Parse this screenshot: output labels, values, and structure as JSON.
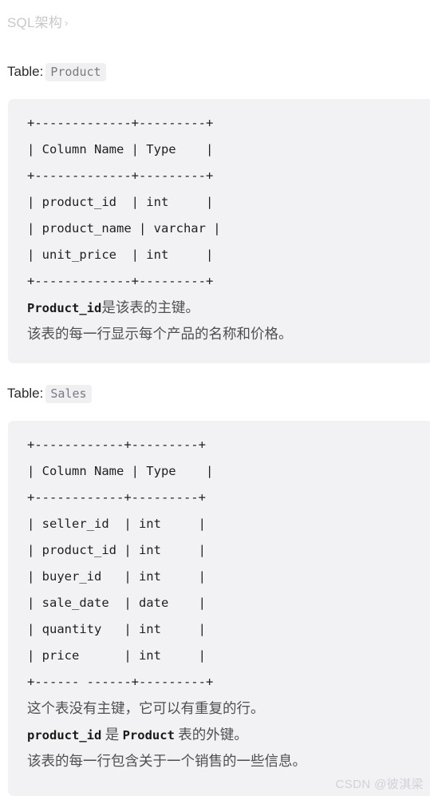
{
  "breadcrumb": {
    "label": "SQL架构",
    "chevron": "›"
  },
  "sections": [
    {
      "heading_label": "Table:",
      "table_name": "Product",
      "code_lines": [
        "+-------------+---------+",
        "| Column Name | Type    |",
        "+-------------+---------+",
        "| product_id  | int     |",
        "| product_name | varchar |",
        "| unit_price  | int     |",
        "+-------------+---------+"
      ],
      "notes": [
        {
          "mono": "Product_id",
          "text": "是该表的主键。"
        },
        {
          "mono": "",
          "text": "该表的每一行显示每个产品的名称和价格。"
        }
      ]
    },
    {
      "heading_label": "Table:",
      "table_name": "Sales",
      "code_lines": [
        "+------------+---------+",
        "| Column Name | Type    |",
        "+------------+---------+",
        "| seller_id  | int     |",
        "| product_id | int     |",
        "| buyer_id   | int     |",
        "| sale_date  | date    |",
        "| quantity   | int     |",
        "| price      | int     |",
        "+------ ------+---------+"
      ],
      "notes": [
        {
          "mono": "",
          "text": "这个表没有主键，它可以有重复的行。"
        },
        {
          "mono": "product_id",
          "text": " 是 ",
          "mono2": "Product",
          "text2": " 表的外键。"
        },
        {
          "mono": "",
          "text": "该表的每一行包含关于一个销售的一些信息。"
        }
      ]
    }
  ],
  "product_code": {
    "l0": "+-------------+---------+",
    "l1": "| Column Name | Type    |",
    "l2": "+-------------+---------+",
    "l3": "| product_id  | int     |",
    "l4": "| product_name | varchar |",
    "l5": "| unit_price  | int     |",
    "l6": "+-------------+---------+"
  },
  "product_notes": {
    "n0_mono": "Product_id",
    "n0_text": "是该表的主键。",
    "n1_text": "该表的每一行显示每个产品的名称和价格。"
  },
  "sales_code": {
    "l0": "+------------+---------+",
    "l1": "| Column Name | Type    |",
    "l2": "+------------+---------+",
    "l3": "| seller_id  | int     |",
    "l4": "| product_id | int     |",
    "l5": "| buyer_id   | int     |",
    "l6": "| sale_date  | date    |",
    "l7": "| quantity   | int     |",
    "l8": "| price      | int     |",
    "l9": "+------ ------+---------+"
  },
  "sales_notes": {
    "n0_text": "这个表没有主键，它可以有重复的行。",
    "n1_mono": "product_id",
    "n1_mid": " 是 ",
    "n1_mono2": "Product",
    "n1_text": " 表的外键。",
    "n2_text": "该表的每一行包含关于一个销售的一些信息。"
  },
  "watermark": "CSDN @彼淇梁",
  "colors": {
    "code_background": "#f2f2f5",
    "tag_background": "#f0f0f3",
    "text": "#1f1f1f",
    "muted": "#c8c8cc",
    "note": "#4f4f4f"
  }
}
